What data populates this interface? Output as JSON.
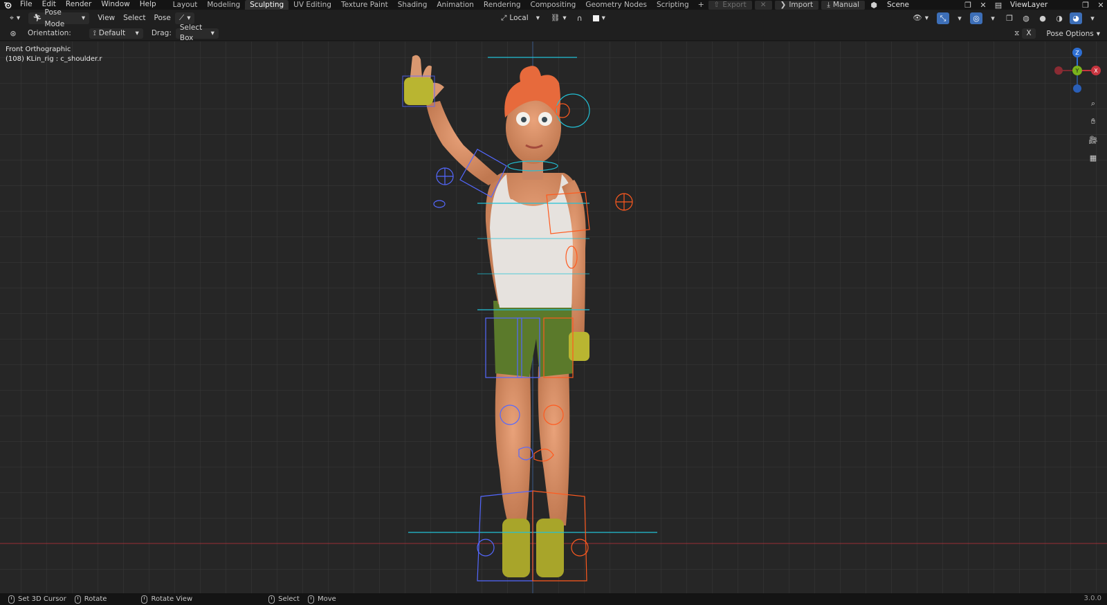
{
  "menu": [
    "File",
    "Edit",
    "Render",
    "Window",
    "Help"
  ],
  "workspace_tabs": [
    {
      "label": "Layout",
      "active": false
    },
    {
      "label": "Modeling",
      "active": false
    },
    {
      "label": "Sculpting",
      "active": true
    },
    {
      "label": "UV Editing",
      "active": false
    },
    {
      "label": "Texture Paint",
      "active": false
    },
    {
      "label": "Shading",
      "active": false
    },
    {
      "label": "Animation",
      "active": false
    },
    {
      "label": "Rendering",
      "active": false
    },
    {
      "label": "Compositing",
      "active": false
    },
    {
      "label": "Geometry Nodes",
      "active": false
    },
    {
      "label": "Scripting",
      "active": false
    }
  ],
  "add_tab_label": "+",
  "top_right": {
    "export_label": "Export",
    "import_label": "Import",
    "manual_label": "Manual",
    "scene_name": "Scene",
    "view_layer": "ViewLayer"
  },
  "header": {
    "mode": "Pose Mode",
    "view": "View",
    "select": "Select",
    "pose": "Pose",
    "transform_orientation": "Local"
  },
  "tool_settings": {
    "orientation_label": "Orientation:",
    "orientation_value": "Default",
    "drag_label": "Drag:",
    "drag_value": "Select Box",
    "x_label": "X",
    "pose_options": "Pose Options"
  },
  "viewport": {
    "view_name": "Front Orthographic",
    "active_info": "(108) KLin_rig : c_shoulder.r",
    "gizmo_labels": {
      "z": "Z",
      "y": "Y",
      "x": "X"
    }
  },
  "statusbar": {
    "items": [
      "Set 3D Cursor",
      "Rotate",
      "Rotate View",
      "Select",
      "Move"
    ],
    "version": "3.0.0"
  },
  "colors": {
    "active_tab": "#2e2e2e",
    "accent_blue": "#3d6fb8",
    "axis_red": "#c8353f",
    "axis_green": "#7ab31c",
    "axis_blue": "#2e6fd4",
    "bone_blue": "#5468ff",
    "bone_orange": "#ff5a1f",
    "bone_cyan": "#22c1d6"
  }
}
